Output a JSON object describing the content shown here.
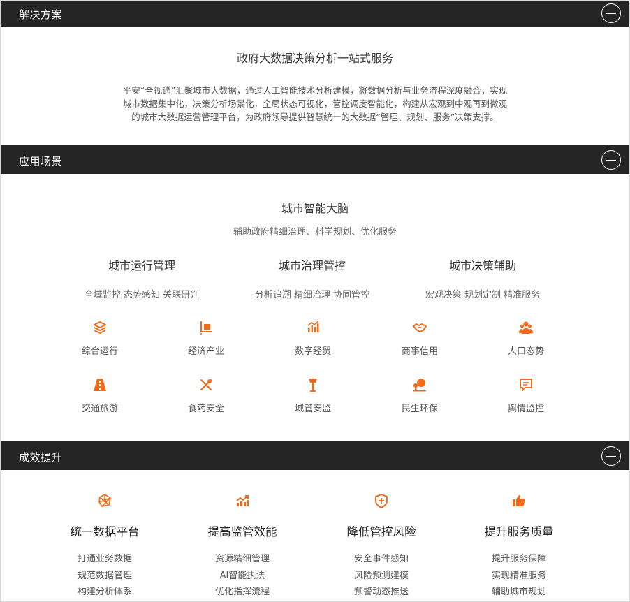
{
  "colors": {
    "bar_bg": "#252526",
    "accent": "#f26b1d"
  },
  "sections": {
    "solution": {
      "title": "解决方案"
    },
    "scenario": {
      "title": "应用场景"
    },
    "effect": {
      "title": "成效提升"
    }
  },
  "solution": {
    "heading": "政府大数据决策分析一站式服务",
    "desc_lines": [
      "平安“全视通”汇聚城市大数据，通过人工智能技术分析建模，将数据分析与业务流程深度融合，实现",
      "城市数据集中化，决策分析场景化，全局状态可视化，管控调度智能化，构建从宏观到中观再到微观",
      "的城市大数据运营管理平台，为政府领导提供智慧统一的大数据“管理、规划、服务”决策支撑。"
    ]
  },
  "scenario": {
    "brain_title": "城市智能大脑",
    "brain_sub": "辅助政府精细治理、科学规划、优化服务",
    "columns": [
      {
        "title": "城市运行管理",
        "sub": "全域监控 态势感知 关联研判"
      },
      {
        "title": "城市治理管控",
        "sub": "分析追溯 精细治理 协同管控"
      },
      {
        "title": "城市决策辅助",
        "sub": "宏观决策 规划定制 精准服务"
      }
    ],
    "items": [
      {
        "label": "综合运行",
        "icon": "layers-icon"
      },
      {
        "label": "经济产业",
        "icon": "economy-chart-icon"
      },
      {
        "label": "数字经贸",
        "icon": "bar-chart-icon"
      },
      {
        "label": "商事信用",
        "icon": "handshake-icon"
      },
      {
        "label": "人口态势",
        "icon": "people-icon"
      },
      {
        "label": "交通旅游",
        "icon": "road-icon"
      },
      {
        "label": "食药安全",
        "icon": "fork-knife-icon"
      },
      {
        "label": "城管安监",
        "icon": "lamp-icon"
      },
      {
        "label": "民生环保",
        "icon": "tree-icon"
      },
      {
        "label": "舆情监控",
        "icon": "chat-icon"
      }
    ]
  },
  "effect": {
    "cards": [
      {
        "title": "统一数据平台",
        "icon": "network-icon",
        "items": [
          "打通业务数据",
          "规范数据管理",
          "构建分析体系"
        ]
      },
      {
        "title": "提高监管效能",
        "icon": "trend-chart-icon",
        "items": [
          "资源精细管理",
          "AI智能执法",
          "优化指挥流程"
        ]
      },
      {
        "title": "降低管控风险",
        "icon": "shield-plus-icon",
        "items": [
          "安全事件感知",
          "风险预测建模",
          "预警动态推送"
        ]
      },
      {
        "title": "提升服务质量",
        "icon": "thumbs-up-icon",
        "items": [
          "提升服务保障",
          "实现精准服务",
          "辅助城市规划"
        ]
      }
    ]
  }
}
